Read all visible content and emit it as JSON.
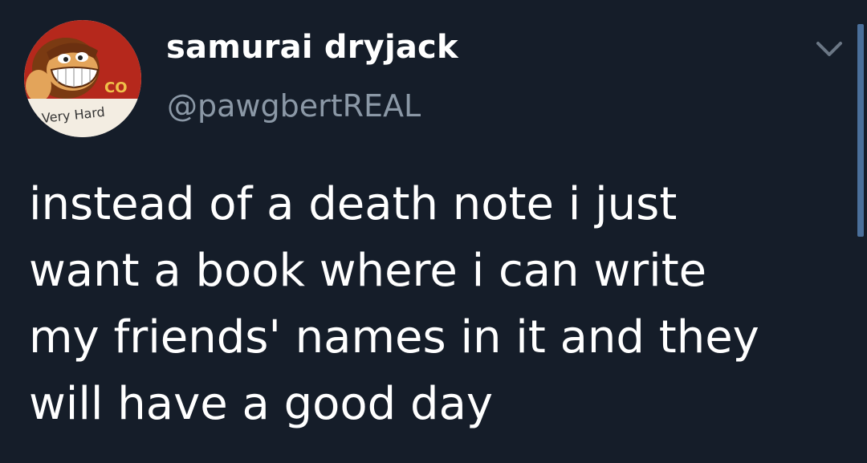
{
  "author": {
    "display_name": "samurai dryjack",
    "handle": "@pawgbertREAL",
    "avatar": {
      "icon": "donkey-kong-avatar-icon",
      "caption": "Very Hard",
      "partial_text": "CO"
    }
  },
  "tweet": {
    "lines": [
      "instead of a death note i just",
      "want a book where i can write",
      "my friends' names in it and they",
      "will have a good day"
    ]
  },
  "menu": {
    "icon": "chevron-down-icon"
  },
  "colors": {
    "background": "#151d29",
    "text": "#ffffff",
    "handle": "#8b98a6",
    "chevron": "#6b7785",
    "accent": "#4a6f9a"
  }
}
